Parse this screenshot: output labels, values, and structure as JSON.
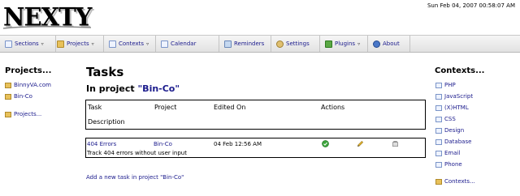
{
  "app": {
    "logo": "NEXTY",
    "datetime": "Sun Feb 04, 2007 00:58:07 AM"
  },
  "nav": [
    {
      "label": "Sections",
      "icon": "sections-icon",
      "dropdown": true
    },
    {
      "label": "Projects",
      "icon": "folder-icon",
      "dropdown": true
    },
    {
      "label": "Contexts",
      "icon": "contexts-icon",
      "dropdown": true
    },
    {
      "label": "Calendar",
      "icon": "calendar-icon",
      "dropdown": false
    },
    {
      "label": "Reminders",
      "icon": "reminders-icon",
      "dropdown": false
    },
    {
      "label": "Settings",
      "icon": "settings-icon",
      "dropdown": false
    },
    {
      "label": "Plugins",
      "icon": "plugins-icon",
      "dropdown": true
    },
    {
      "label": "About",
      "icon": "about-icon",
      "dropdown": false
    }
  ],
  "projects": {
    "title": "Projects...",
    "items": [
      "BinnyVA.com",
      "Bin-Co"
    ],
    "more": "Projects..."
  },
  "main": {
    "title": "Tasks",
    "subtitle_prefix": "In project ",
    "subtitle_project": "\"Bin-Co\"",
    "headers": {
      "task": "Task",
      "project": "Project",
      "edited": "Edited On",
      "actions": "Actions",
      "description": "Description"
    },
    "tasks": [
      {
        "task": "404 Errors",
        "project": "Bin-Co",
        "edited": "04 Feb 12:56 AM",
        "description": "Track 404 errors without user input"
      }
    ],
    "add_link": "Add a new task in project \"Bin-Co\""
  },
  "contexts": {
    "title": "Contexts...",
    "items": [
      "PHP",
      "JavaScript",
      "(X)HTML",
      "CSS",
      "Design",
      "Database",
      "Email",
      "Phone"
    ],
    "more": "Contexts..."
  },
  "colors": {
    "link": "#1a1a8c",
    "folder": "#e8c15a",
    "done": "#3aa33a"
  }
}
